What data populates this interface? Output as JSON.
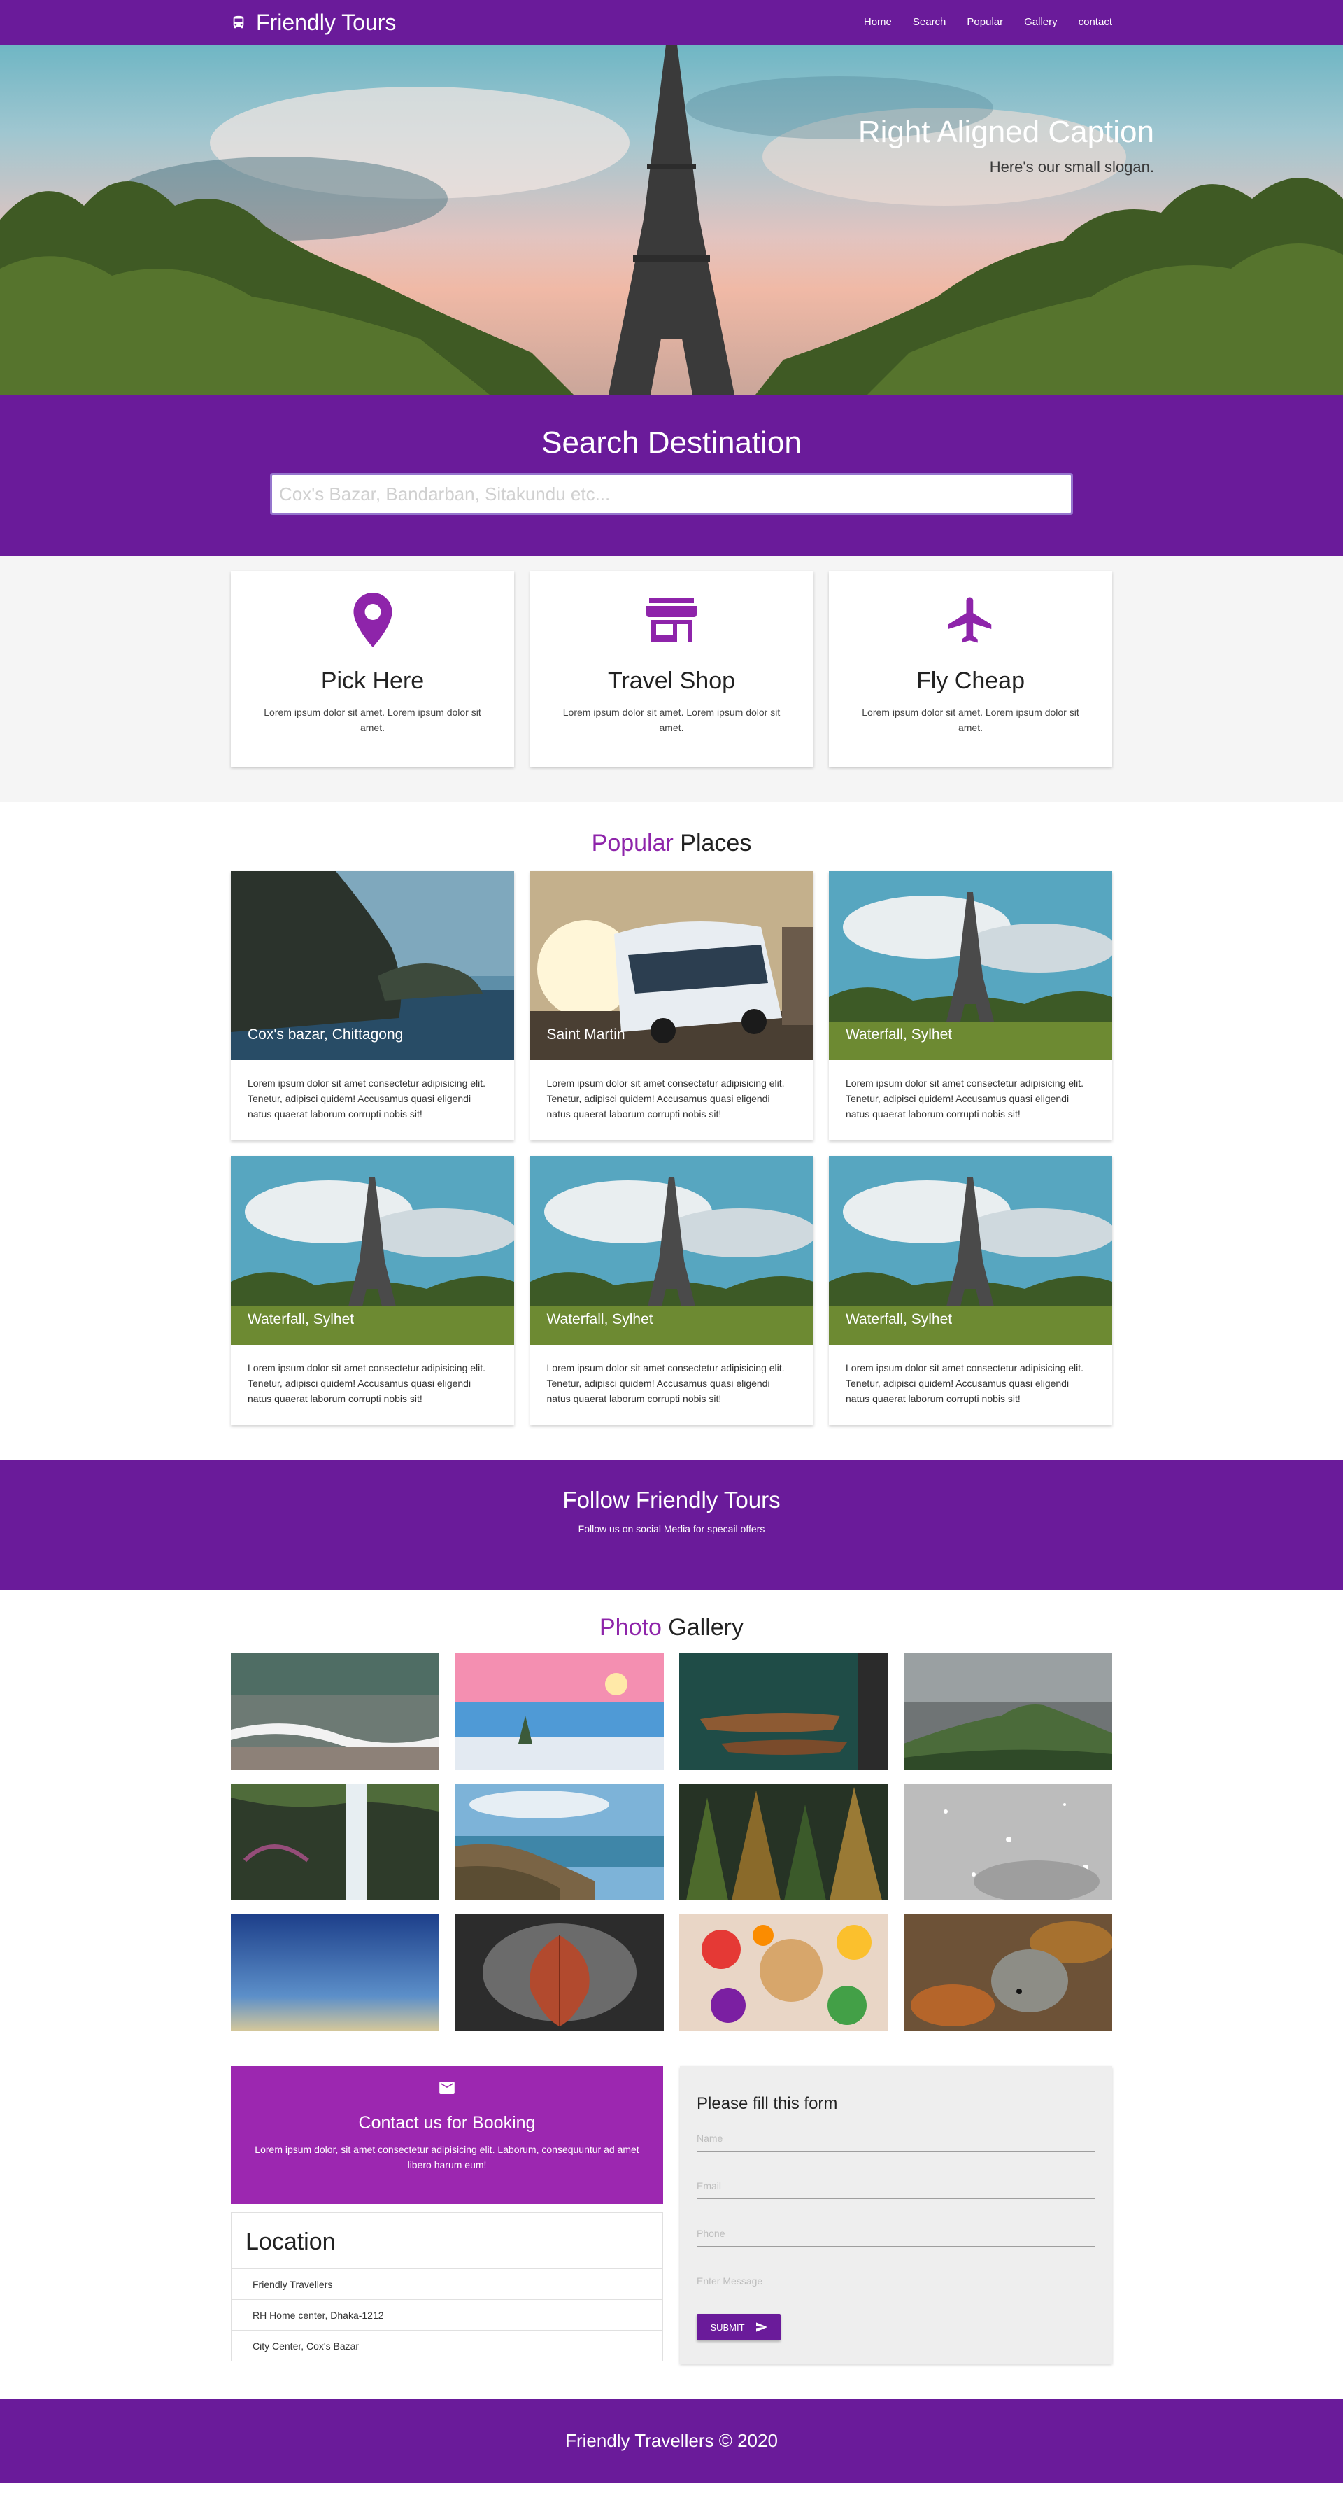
{
  "nav": {
    "brand": "Friendly Tours",
    "links": [
      "Home",
      "Search",
      "Popular",
      "Gallery",
      "contact"
    ]
  },
  "hero": {
    "caption_title": "Right Aligned Caption",
    "caption_slogan": "Here's our small slogan."
  },
  "search": {
    "title": "Search Destination",
    "placeholder": "Cox's Bazar, Bandarban, Sitakundu etc..."
  },
  "features": [
    {
      "icon": "map-pin-icon",
      "title": "Pick Here",
      "text": "Lorem ipsum dolor sit amet. Lorem ipsum dolor sit amet."
    },
    {
      "icon": "shop-icon",
      "title": "Travel Shop",
      "text": "Lorem ipsum dolor sit amet. Lorem ipsum dolor sit amet."
    },
    {
      "icon": "airplane-icon",
      "title": "Fly Cheap",
      "text": "Lorem ipsum dolor sit amet. Lorem ipsum dolor sit amet."
    }
  ],
  "popular": {
    "title_accent": "Popular",
    "title_rest": " Places",
    "places": [
      {
        "title": "Cox's bazar, Chittagong",
        "text": "Lorem ipsum dolor sit amet consectetur adipisicing elit. Tenetur, adipisci quidem! Accusamus quasi eligendi natus quaerat laborum corrupti nobis sit!"
      },
      {
        "title": "Saint Martin",
        "text": "Lorem ipsum dolor sit amet consectetur adipisicing elit. Tenetur, adipisci quidem! Accusamus quasi eligendi natus quaerat laborum corrupti nobis sit!"
      },
      {
        "title": "Waterfall, Sylhet",
        "text": "Lorem ipsum dolor sit amet consectetur adipisicing elit. Tenetur, adipisci quidem! Accusamus quasi eligendi natus quaerat laborum corrupti nobis sit!"
      },
      {
        "title": "Waterfall, Sylhet",
        "text": "Lorem ipsum dolor sit amet consectetur adipisicing elit. Tenetur, adipisci quidem! Accusamus quasi eligendi natus quaerat laborum corrupti nobis sit!"
      },
      {
        "title": "Waterfall, Sylhet",
        "text": "Lorem ipsum dolor sit amet consectetur adipisicing elit. Tenetur, adipisci quidem! Accusamus quasi eligendi natus quaerat laborum corrupti nobis sit!"
      },
      {
        "title": "Waterfall, Sylhet",
        "text": "Lorem ipsum dolor sit amet consectetur adipisicing elit. Tenetur, adipisci quidem! Accusamus quasi eligendi natus quaerat laborum corrupti nobis sit!"
      }
    ]
  },
  "follow": {
    "title": "Follow Friendly Tours",
    "subtitle": "Follow us on social Media for specail offers"
  },
  "gallery": {
    "title_accent": "Photo",
    "title_rest": " Gallery"
  },
  "contact": {
    "booking_title": "Contact us for Booking",
    "booking_text": "Lorem ipsum dolor, sit amet consectetur adipisicing elit. Laborum, consequuntur ad amet libero harum eum!",
    "location_title": "Location",
    "locations": [
      "Friendly Travellers",
      "RH Home center, Dhaka-1212",
      "City Center, Cox's Bazar"
    ],
    "form_title": "Please fill this form",
    "fields": [
      "Name",
      "Email",
      "Phone",
      "Enter Message"
    ],
    "submit_label": "SUBMIT"
  },
  "footer": {
    "text": "Friendly Travellers © 2020"
  },
  "colors": {
    "primary": "#6a1b9a",
    "accent": "#8e24aa",
    "booking": "#9c27b0"
  }
}
